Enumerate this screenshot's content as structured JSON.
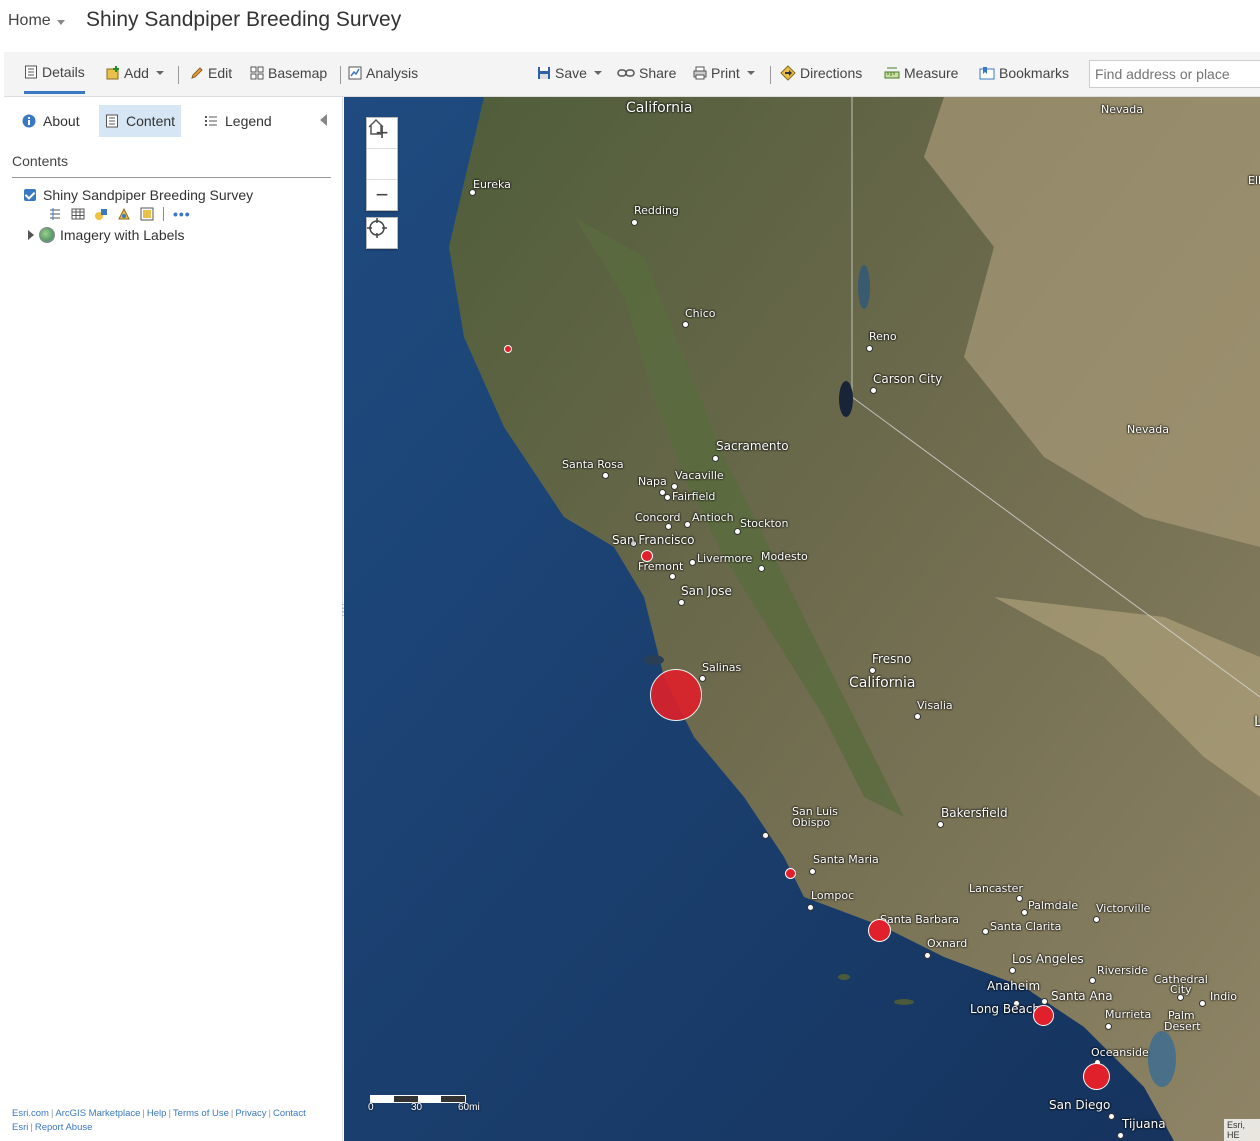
{
  "header": {
    "home_label": "Home",
    "title": "Shiny Sandpiper Breeding Survey"
  },
  "toolbar": {
    "details": "Details",
    "add": "Add",
    "edit": "Edit",
    "basemap": "Basemap",
    "analysis": "Analysis",
    "save": "Save",
    "share": "Share",
    "print": "Print",
    "directions": "Directions",
    "measure": "Measure",
    "bookmarks": "Bookmarks",
    "search_placeholder": "Find address or place"
  },
  "sidebar": {
    "tabs": {
      "about": "About",
      "content": "Content",
      "legend": "Legend"
    },
    "contents_label": "Contents",
    "layers": [
      "Shiny Sandpiper Breeding Survey",
      "Imagery with Labels"
    ]
  },
  "footer": {
    "links_row1": [
      "Esri.com",
      "ArcGIS Marketplace",
      "Help",
      "Terms of Use",
      "Privacy",
      "Contact"
    ],
    "links_row2": [
      "Esri",
      "Report Abuse"
    ]
  },
  "map": {
    "zoom_in": "+",
    "zoom_out": "−",
    "scale_labels": [
      "0",
      "30",
      "60mi"
    ],
    "attribution": "Esri, HE",
    "labels": {
      "california_top": "California",
      "nevada_top": "Nevada",
      "eureka": "Eureka",
      "redding": "Redding",
      "elko": "Elko",
      "chico": "Chico",
      "reno": "Reno",
      "carson_city": "Carson City",
      "nevada": "Nevada",
      "sacramento": "Sacramento",
      "santa_rosa": "Santa Rosa",
      "vacaville": "Vacaville",
      "napa": "Napa",
      "fairfield": "Fairfield",
      "concord": "Concord",
      "antioch": "Antioch",
      "stockton": "Stockton",
      "san_francisco": "San Francisco",
      "livermore": "Livermore",
      "modesto": "Modesto",
      "fremont": "Fremont",
      "san_jose": "San Jose",
      "salinas": "Salinas",
      "fresno": "Fresno",
      "california": "California",
      "visalia": "Visalia",
      "san_luis": "San Luis",
      "obispo": "Obispo",
      "bakersfield": "Bakersfield",
      "santa_maria": "Santa Maria",
      "lompoc": "Lompoc",
      "lancaster": "Lancaster",
      "palmdale": "Palmdale",
      "victorville": "Victorville",
      "santa_barbara": "Santa Barbara",
      "santa_clarita": "Santa Clarita",
      "oxnard": "Oxnard",
      "los_angeles": "Los Angeles",
      "riverside": "Riverside",
      "cathedral": "Cathedral",
      "city": "City",
      "indio": "Indio",
      "anaheim": "Anaheim",
      "santa_ana": "Santa Ana",
      "long_beach": "Long Beach",
      "murrieta": "Murrieta",
      "palm": "Palm",
      "desert": "Desert",
      "oceanside": "Oceanside",
      "san_diego": "San Diego",
      "tijuana": "Tijuana",
      "l": "L"
    },
    "observation_color": "#e0202a"
  }
}
